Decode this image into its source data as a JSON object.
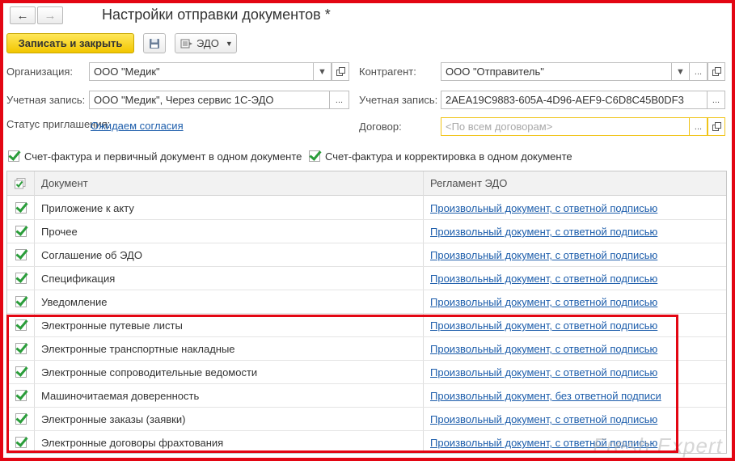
{
  "window": {
    "title": "Настройки отправки документов *"
  },
  "toolbar": {
    "save_close_label": "Записать и закрыть",
    "edo_label": "ЭДО"
  },
  "form": {
    "organization": {
      "label": "Организация:",
      "value": "ООО \"Медик\""
    },
    "account": {
      "label": "Учетная запись:",
      "value": "ООО \"Медик\", Через сервис 1С-ЭДО"
    },
    "invite_status": {
      "label": "Статус приглашения:",
      "value": "Ожидаем согласия"
    },
    "counterparty": {
      "label": "Контрагент:",
      "value": "ООО \"Отправитель\""
    },
    "cp_account": {
      "label": "Учетная запись:",
      "value": "2AEA19C9883-605A-4D96-AEF9-C6D8C45B0DF3"
    },
    "contract": {
      "label": "Договор:",
      "placeholder": "<По всем договорам>"
    }
  },
  "options": {
    "invoice_primary": {
      "label": "Счет-фактура и первичный документ в одном документе",
      "checked": true
    },
    "invoice_correction": {
      "label": "Счет-фактура и корректировка в одном документе",
      "checked": true
    }
  },
  "table": {
    "columns": [
      "Документ",
      "Регламент ЭДО"
    ],
    "rows": [
      {
        "checked": true,
        "document": "Приложение к акту",
        "regulation": "Произвольный документ, с ответной подписью"
      },
      {
        "checked": true,
        "document": "Прочее",
        "regulation": "Произвольный документ, с ответной подписью"
      },
      {
        "checked": true,
        "document": "Соглашение об ЭДО",
        "regulation": "Произвольный документ, с ответной подписью"
      },
      {
        "checked": true,
        "document": "Спецификация",
        "regulation": "Произвольный документ, с ответной подписью"
      },
      {
        "checked": true,
        "document": "Уведомление",
        "regulation": "Произвольный документ, с ответной подписью"
      },
      {
        "checked": true,
        "document": "Электронные путевые листы",
        "regulation": "Произвольный документ, с ответной подписью"
      },
      {
        "checked": true,
        "document": "Электронные транспортные накладные",
        "regulation": "Произвольный документ, с ответной подписью"
      },
      {
        "checked": true,
        "document": "Электронные сопроводительные ведомости",
        "regulation": "Произвольный документ, с ответной подписью"
      },
      {
        "checked": true,
        "document": "Машиночитаемая доверенность",
        "regulation": "Произвольный документ, без ответной подписи"
      },
      {
        "checked": true,
        "document": "Электронные заказы (заявки)",
        "regulation": "Произвольный документ, с ответной подписью"
      },
      {
        "checked": true,
        "document": "Электронные договоры фрахтования",
        "regulation": "Произвольный документ, с ответной подписью"
      }
    ]
  },
  "watermark": "Fresh Expert",
  "colors": {
    "accent_frame": "#e30613",
    "primary_button": "#f2c600",
    "link": "#1c5dab",
    "check": "#2a9d3a"
  }
}
